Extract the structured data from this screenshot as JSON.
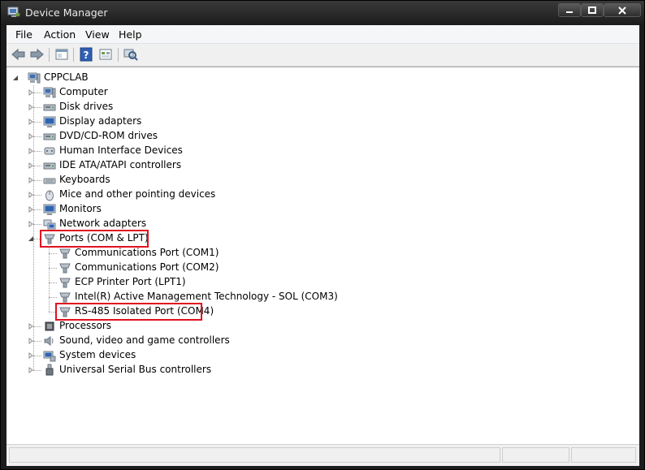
{
  "window": {
    "title": "Device Manager"
  },
  "menu": {
    "items": [
      "File",
      "Action",
      "View",
      "Help"
    ]
  },
  "toolbar": {
    "buttons": [
      "back-icon",
      "forward-icon",
      "properties-icon",
      "help-icon",
      "update-driver-icon",
      "scan-hardware-icon"
    ]
  },
  "tree": {
    "root": "CPPCLAB",
    "categories": [
      "Computer",
      "Disk drives",
      "Display adapters",
      "DVD/CD-ROM drives",
      "Human Interface Devices",
      "IDE ATA/ATAPI controllers",
      "Keyboards",
      "Mice and other pointing devices",
      "Monitors",
      "Network adapters",
      "Ports (COM & LPT)",
      "Processors",
      "Sound, video and game controllers",
      "System devices",
      "Universal Serial Bus controllers"
    ],
    "ports_children": [
      "Communications Port (COM1)",
      "Communications Port (COM2)",
      "ECP Printer Port (LPT1)",
      "Intel(R) Active Management Technology - SOL (COM3)",
      "RS-485 Isolated Port (COM4)"
    ]
  },
  "highlight_color": "#e0111f"
}
